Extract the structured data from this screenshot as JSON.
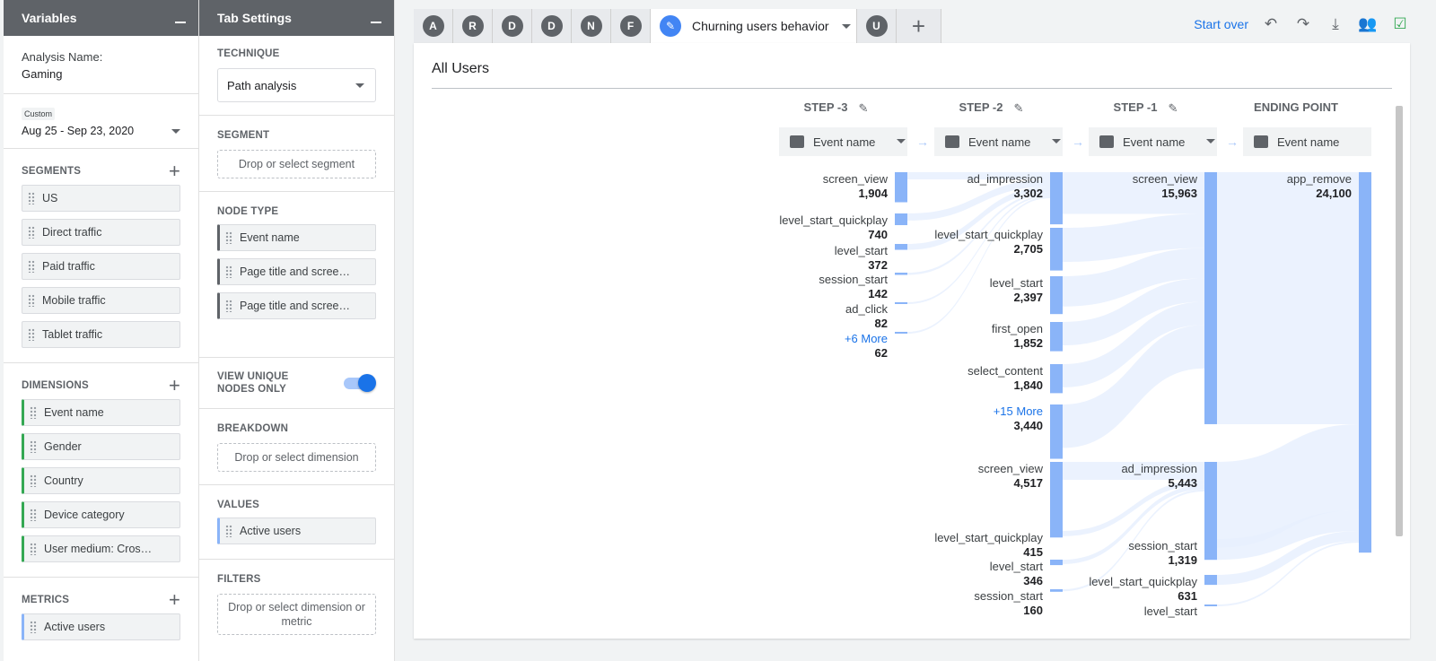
{
  "variables": {
    "title": "Variables",
    "analysis_label": "Analysis Name:",
    "analysis_name": "Gaming",
    "date_badge": "Custom",
    "date_range": "Aug 25 - Sep 23, 2020",
    "segments_title": "SEGMENTS",
    "segments": [
      "US",
      "Direct traffic",
      "Paid traffic",
      "Mobile traffic",
      "Tablet traffic"
    ],
    "dimensions_title": "DIMENSIONS",
    "dimensions": [
      "Event name",
      "Gender",
      "Country",
      "Device category",
      "User medium: Cros…"
    ],
    "metrics_title": "METRICS",
    "metrics": [
      "Active users"
    ]
  },
  "tab_settings": {
    "title": "Tab Settings",
    "technique_title": "TECHNIQUE",
    "technique_value": "Path analysis",
    "segment_title": "SEGMENT",
    "segment_drop": "Drop or select segment",
    "node_type_title": "NODE TYPE",
    "node_types": [
      "Event name",
      "Page title and scree…",
      "Page title and scree…"
    ],
    "unique_nodes_label": "VIEW UNIQUE NODES ONLY",
    "breakdown_title": "BREAKDOWN",
    "breakdown_drop": "Drop or select dimension",
    "values_title": "VALUES",
    "values_item": "Active users",
    "filters_title": "FILTERS",
    "filters_drop": "Drop or select dimension or metric"
  },
  "tabs": {
    "avatars": [
      "A",
      "R",
      "D",
      "D",
      "N",
      "F"
    ],
    "active_title": "Churning users behavior",
    "after_avatar": "U"
  },
  "toolbar": {
    "start_over": "Start over"
  },
  "canvas": {
    "segment_title": "All Users",
    "step_headers": [
      "STEP -3",
      "STEP -2",
      "STEP -1",
      "ENDING POINT"
    ],
    "node_selector": "Event name"
  },
  "colors": {
    "node": "#8ab4f8",
    "link": "#e8f0fe",
    "accent": "#1a73e8"
  },
  "chart_data": {
    "type": "sankey",
    "columns": [
      {
        "header": "STEP -3",
        "nodes": [
          {
            "name": "screen_view",
            "value": 1904
          },
          {
            "name": "level_start_quickplay",
            "value": 740
          },
          {
            "name": "level_start",
            "value": 372
          },
          {
            "name": "session_start",
            "value": 142
          },
          {
            "name": "ad_click",
            "value": 82
          },
          {
            "name": "+6 More",
            "value": 62
          }
        ]
      },
      {
        "header": "STEP -2",
        "nodes": [
          {
            "name": "ad_impression",
            "value": 3302
          },
          {
            "name": "level_start_quickplay",
            "value": 2705
          },
          {
            "name": "level_start",
            "value": 2397
          },
          {
            "name": "first_open",
            "value": 1852
          },
          {
            "name": "select_content",
            "value": 1840
          },
          {
            "name": "+15 More",
            "value": 3440
          },
          {
            "name": "screen_view",
            "value": 4517
          },
          {
            "name": "level_start_quickplay",
            "value": 415
          },
          {
            "name": "level_start",
            "value": 346
          },
          {
            "name": "session_start",
            "value": 160
          }
        ]
      },
      {
        "header": "STEP -1",
        "nodes": [
          {
            "name": "screen_view",
            "value": 15963
          },
          {
            "name": "ad_impression",
            "value": 5443
          },
          {
            "name": "session_start",
            "value": 1319
          },
          {
            "name": "level_start_quickplay",
            "value": 631
          },
          {
            "name": "level_start",
            "value": null
          }
        ]
      },
      {
        "header": "ENDING POINT",
        "nodes": [
          {
            "name": "app_remove",
            "value": 24100
          }
        ]
      }
    ]
  }
}
